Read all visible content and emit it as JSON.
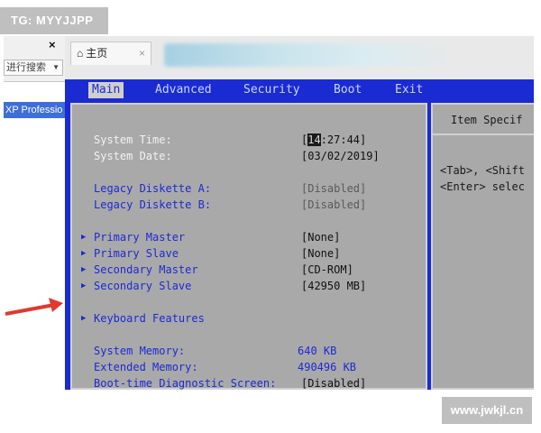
{
  "watermarks": {
    "top": "TG: MYYJJPP",
    "bottom": "www.jwkjl.cn"
  },
  "sidebar": {
    "close": "×",
    "search_text": "进行搜索",
    "item": "XP Professio"
  },
  "tab": {
    "label": "主页",
    "close": "×"
  },
  "bios": {
    "menu": [
      "Main",
      "Advanced",
      "Security",
      "Boot",
      "Exit"
    ],
    "active_menu": "Main",
    "help_title": "Item Specif",
    "help_lines": [
      "<Tab>, <Shift",
      "<Enter> selec"
    ],
    "fields": [
      {
        "label": "System Time:",
        "value_cursor": "14",
        "value_rest": ":27:44]",
        "value_prefix": "["
      },
      {
        "label": "System Date:",
        "value": "[03/02/2019]"
      },
      {
        "label": "Legacy Diskette A:",
        "value": "[Disabled]"
      },
      {
        "label": "Legacy Diskette B:",
        "value": "[Disabled]"
      },
      {
        "label": "Primary Master",
        "value": "[None]"
      },
      {
        "label": "Primary Slave",
        "value": "[None]"
      },
      {
        "label": "Secondary Master",
        "value": "[CD-ROM]"
      },
      {
        "label": "Secondary Slave",
        "value": "[42950 MB]"
      },
      {
        "label": "Keyboard Features"
      },
      {
        "label": "System Memory:",
        "value": "640 KB"
      },
      {
        "label": "Extended Memory:",
        "value": "490496 KB"
      },
      {
        "label": "Boot-time Diagnostic Screen:",
        "value": "[Disabled]"
      }
    ]
  },
  "colors": {
    "bios_blue": "#1b2bd2",
    "bios_gray": "#a9a9a9",
    "arrow_red": "#e03a2e"
  },
  "icons": {
    "tab": "home-icon",
    "submenu": "triangle-right-icon",
    "pointer": "red-arrow-icon"
  }
}
